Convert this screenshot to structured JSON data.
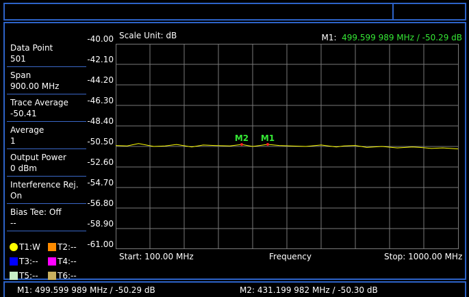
{
  "left_panel": [
    {
      "label": "Data Point",
      "value": "501"
    },
    {
      "label": "Span",
      "value": "900.00 MHz"
    },
    {
      "label": "Trace Average",
      "value": "-50.41"
    },
    {
      "label": "Average",
      "value": "1"
    },
    {
      "label": "Output Power",
      "value": "0 dBm"
    },
    {
      "label": "Interference Rej.",
      "value": "On"
    },
    {
      "label": "Bias Tee: Off",
      "value": "--"
    }
  ],
  "legend": [
    {
      "label": "T1:W",
      "color": "#ffff00",
      "shape": "circle"
    },
    {
      "label": "T2:--",
      "color": "#ff8c00",
      "shape": "square"
    },
    {
      "label": "T3:--",
      "color": "#0000ff",
      "shape": "square"
    },
    {
      "label": "T4:--",
      "color": "#ff00ff",
      "shape": "square"
    },
    {
      "label": "T5:--",
      "color": "#c8f0c8",
      "shape": "square"
    },
    {
      "label": "T6:--",
      "color": "#c8b060",
      "shape": "square"
    }
  ],
  "scale_unit": "Scale Unit: dB",
  "marker_readout_key": "M1:",
  "marker_readout_value": "499.599 989 MHz / -50.29  dB",
  "x_start_label": "Start: 100.00 MHz",
  "x_axis_label": "Frequency",
  "x_stop_label": "Stop: 1000.00 MHz",
  "bottom_m1": "M1: 499.599 989 MHz / -50.29  dB",
  "bottom_m2": "M2: 431.199 982 MHz / -50.30  dB",
  "colors": {
    "trace": "#ffff00",
    "marker_label": "#35e835",
    "marker_dot": "#ff2020",
    "grid": "#7a7a7a",
    "frame": "#2d63c8"
  },
  "chart_data": {
    "type": "line",
    "ylim": [
      -61.0,
      -40.0
    ],
    "xlim": [
      100,
      1000
    ],
    "y_ticks": [
      "-40.00",
      "-42.10",
      "-44.20",
      "-46.30",
      "-48.40",
      "-50.50",
      "-52.60",
      "-54.70",
      "-56.80",
      "-58.90",
      "-61.00"
    ],
    "grid": true,
    "series": [
      {
        "values_x": [
          100,
          130,
          160,
          200,
          230,
          260,
          300,
          330,
          360,
          400,
          431.2,
          460,
          499.6,
          530,
          560,
          600,
          640,
          680,
          700,
          730,
          760,
          800,
          840,
          880,
          900,
          930,
          960,
          1000
        ],
        "values_y": [
          -50.4,
          -50.45,
          -50.2,
          -50.5,
          -50.45,
          -50.3,
          -50.55,
          -50.35,
          -50.4,
          -50.45,
          -50.3,
          -50.5,
          -50.29,
          -50.4,
          -50.45,
          -50.5,
          -50.35,
          -50.55,
          -50.45,
          -50.4,
          -50.6,
          -50.5,
          -50.65,
          -50.55,
          -50.6,
          -50.7,
          -50.65,
          -50.75
        ]
      }
    ],
    "markers": [
      {
        "label": "M1",
        "x": 499.6,
        "y": -50.29
      },
      {
        "label": "M2",
        "x": 431.2,
        "y": -50.3
      }
    ]
  }
}
